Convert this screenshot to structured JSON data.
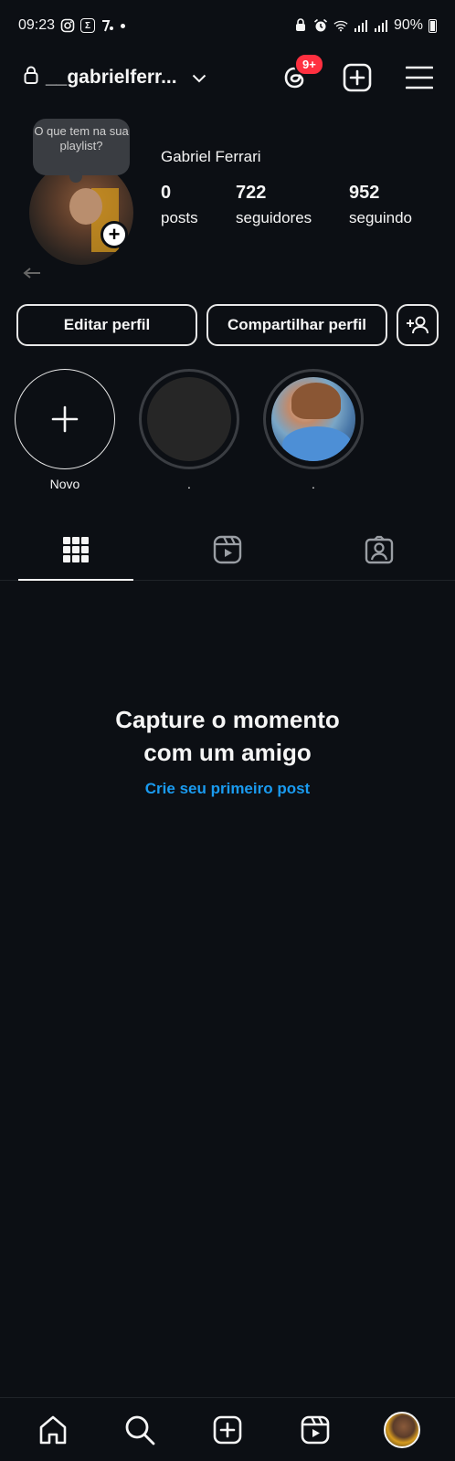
{
  "status_bar": {
    "time": "09:23",
    "battery": "90%",
    "notification_icons": [
      "instagram-icon",
      "e-app-icon",
      "flash-app-icon"
    ],
    "system_icons": [
      "alarm-lock-icon",
      "alarm-clock-icon",
      "wifi-icon",
      "signal-icon",
      "signal-icon"
    ]
  },
  "header": {
    "username": "__gabrielferr...",
    "threads_badge": "9+"
  },
  "profile": {
    "note": "O que tem na sua playlist?",
    "name": "Gabriel Ferrari",
    "stats": [
      {
        "value": "0",
        "label": "posts"
      },
      {
        "value": "722",
        "label": "seguidores"
      },
      {
        "value": "952",
        "label": "seguindo"
      }
    ]
  },
  "buttons": {
    "edit": "Editar perfil",
    "share": "Compartilhar perfil"
  },
  "highlights": [
    {
      "label": "Novo"
    },
    {
      "label": "."
    },
    {
      "label": "."
    }
  ],
  "tabs": [
    "grid-icon",
    "reels-icon",
    "tagged-icon"
  ],
  "empty_state": {
    "title": "Capture o momento com um amigo",
    "link": "Crie seu primeiro post"
  },
  "nav": [
    "home-icon",
    "search-icon",
    "create-icon",
    "reels-icon",
    "profile-avatar"
  ]
}
